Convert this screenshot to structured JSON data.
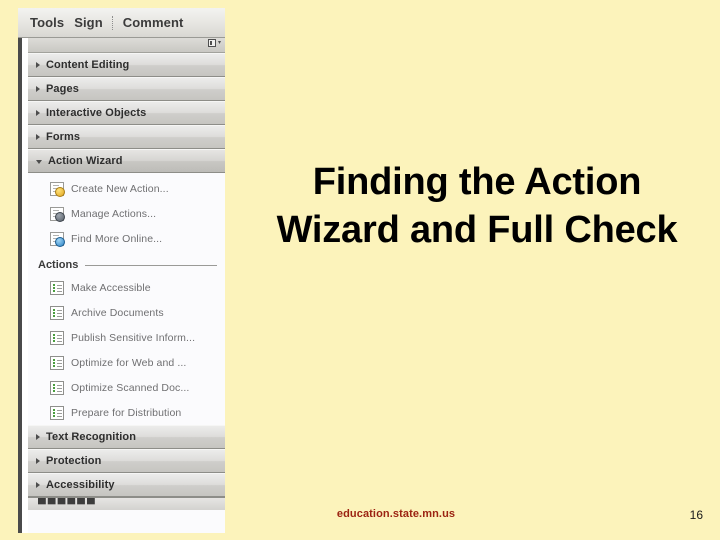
{
  "slide": {
    "title": "Finding the Action Wizard and Full Check",
    "footer_url": "education.state.mn.us",
    "page_number": "16",
    "background_color": "#FCF3BB",
    "title_color": "#000000",
    "footer_color": "#9B2312"
  },
  "acrobat": {
    "menubar": {
      "items": [
        {
          "label": "Tools"
        },
        {
          "label": "Sign"
        },
        {
          "label": "Comment"
        }
      ]
    },
    "panel": {
      "options_icon": "panel-options-icon",
      "categories": [
        {
          "label": "Content Editing",
          "expanded": false,
          "icon": "chevron-right-icon"
        },
        {
          "label": "Pages",
          "expanded": false,
          "icon": "chevron-right-icon"
        },
        {
          "label": "Interactive Objects",
          "expanded": false,
          "icon": "chevron-right-icon"
        },
        {
          "label": "Forms",
          "expanded": false,
          "icon": "chevron-right-icon"
        },
        {
          "label": "Action Wizard",
          "expanded": true,
          "icon": "chevron-down-icon"
        }
      ],
      "wizard_commands": [
        {
          "label": "Create New Action...",
          "icon": "create-new-action-icon"
        },
        {
          "label": "Manage Actions...",
          "icon": "manage-actions-icon"
        },
        {
          "label": "Find More Online...",
          "icon": "find-more-online-icon"
        }
      ],
      "actions_section_label": "Actions",
      "actions": [
        {
          "label": "Make Accessible",
          "icon": "action-item-icon"
        },
        {
          "label": "Archive Documents",
          "icon": "action-item-icon"
        },
        {
          "label": "Publish Sensitive Inform...",
          "icon": "action-item-icon"
        },
        {
          "label": "Optimize for Web and ...",
          "icon": "action-item-icon"
        },
        {
          "label": "Optimize Scanned Doc...",
          "icon": "action-item-icon"
        },
        {
          "label": "Prepare for Distribution",
          "icon": "action-item-icon"
        }
      ],
      "categories_bottom": [
        {
          "label": "Text Recognition",
          "expanded": false,
          "icon": "chevron-right-icon"
        },
        {
          "label": "Protection",
          "expanded": false,
          "icon": "chevron-right-icon"
        },
        {
          "label": "Accessibility",
          "expanded": false,
          "icon": "chevron-right-icon"
        }
      ],
      "clipped_row_text": "██████",
      "clipped_row_accent": "██"
    }
  }
}
